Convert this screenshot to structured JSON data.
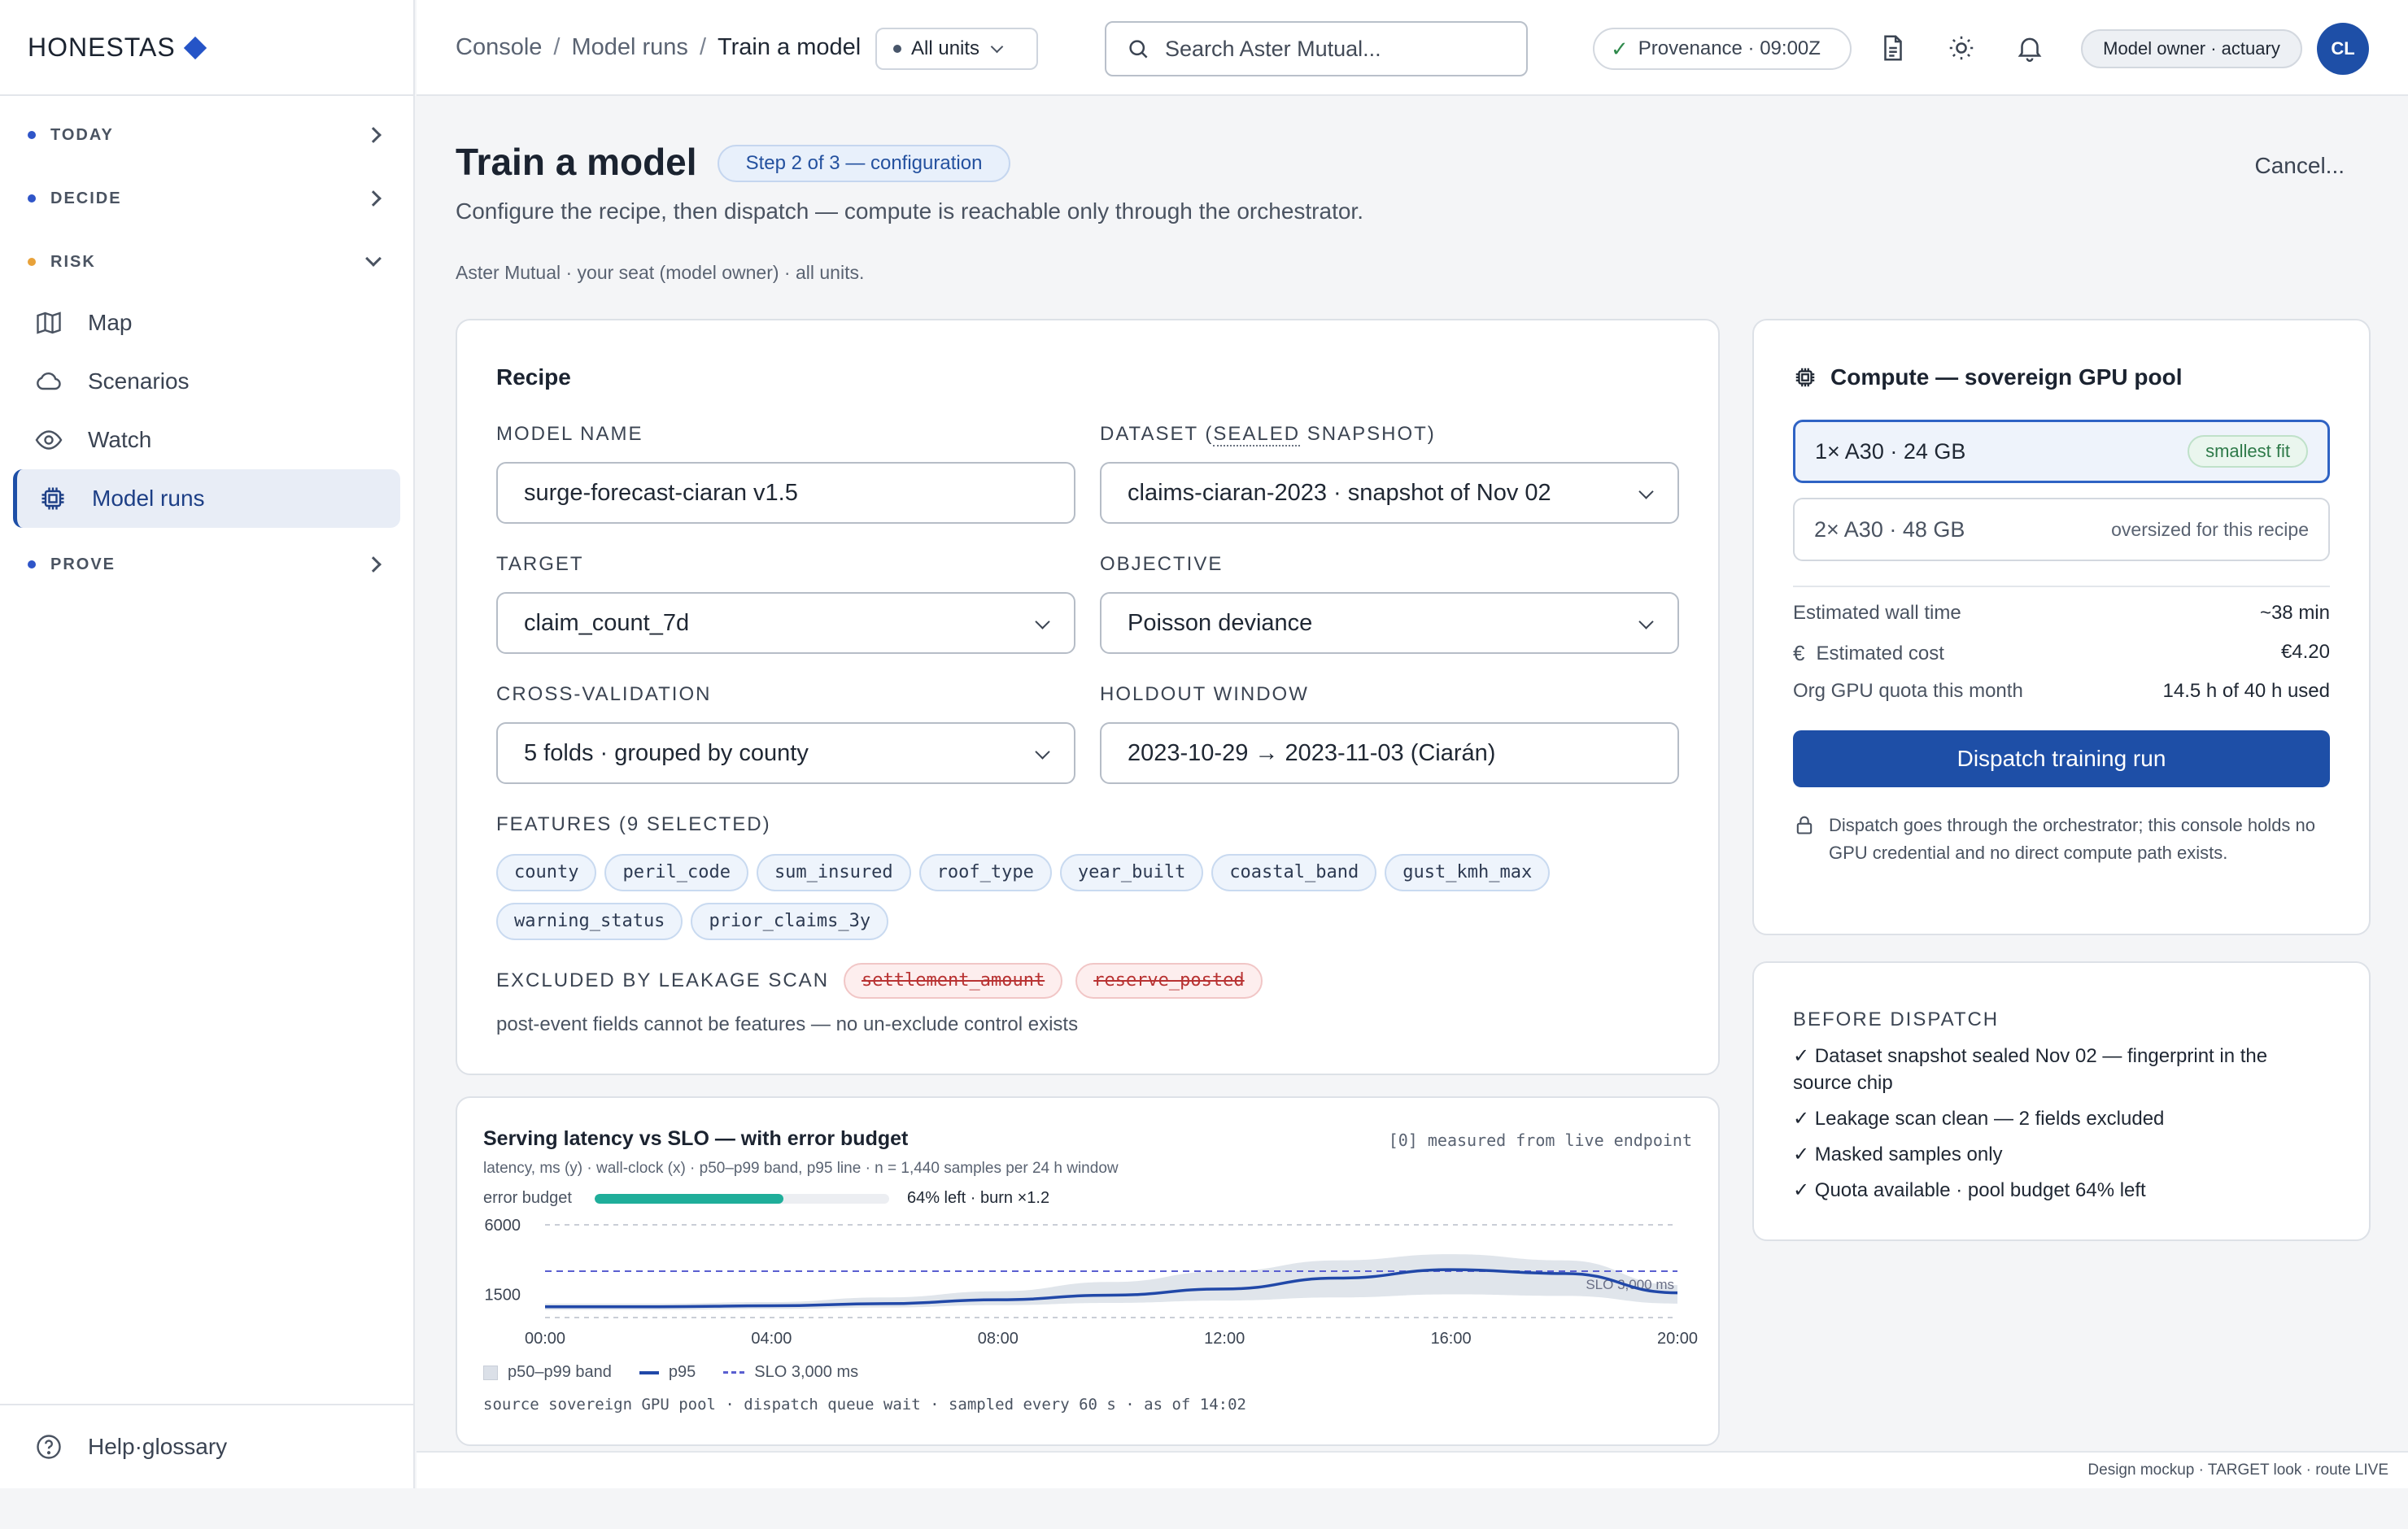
{
  "brand": {
    "name": "HONESTAS"
  },
  "sidebar": {
    "sections": [
      {
        "label": "TODAY"
      },
      {
        "label": "DECIDE"
      },
      {
        "label": "RISK"
      },
      {
        "label": "PROVE"
      }
    ],
    "items": [
      {
        "label": "Map",
        "icon": "map-icon"
      },
      {
        "label": "Scenarios",
        "icon": "cloud-icon"
      },
      {
        "label": "Watch",
        "icon": "eye-icon"
      },
      {
        "label": "Model runs",
        "icon": "chip-icon"
      }
    ],
    "help": "Help·glossary",
    "colors": {
      "accent": "#1e4fa7",
      "risk_dot": "#e8a23a"
    }
  },
  "topbar": {
    "breadcrumb": [
      "Console",
      "Model runs",
      "Train a model"
    ],
    "units": "All units",
    "search_placeholder": "Search Aster Mutual...",
    "provenance": "Provenance · 09:00Z",
    "role": "Model owner · actuary",
    "avatar": "CL"
  },
  "page": {
    "title": "Train a model",
    "step": "Step 2 of 3 — configuration",
    "cancel": "Cancel...",
    "subtitle": "Configure the recipe, then dispatch — compute is reachable only through the orchestrator.",
    "context": "Aster Mutual · your seat (model owner) · all units."
  },
  "recipe": {
    "heading": "Recipe",
    "model_name_label": "MODEL NAME",
    "model_name": "surge-forecast-ciaran v1.5",
    "dataset_label_pre": "DATASET (",
    "dataset_label_sealed": "SEALED",
    "dataset_label_post": " SNAPSHOT)",
    "dataset": "claims-ciaran-2023 · snapshot of Nov 02",
    "target_label": "TARGET",
    "target": "claim_count_7d",
    "objective_label": "OBJECTIVE",
    "objective": "Poisson deviance",
    "cv_label": "CROSS-VALIDATION",
    "cv": "5 folds · grouped by county",
    "holdout_label": "HOLDOUT WINDOW",
    "holdout": "2023-10-29 → 2023-11-03 (Ciarán)",
    "features_label": "FEATURES (9 SELECTED)",
    "features": [
      "county",
      "peril_code",
      "sum_insured",
      "roof_type",
      "year_built",
      "coastal_band",
      "gust_kmh_max",
      "warning_status",
      "prior_claims_3y"
    ],
    "excluded_label": "EXCLUDED BY LEAKAGE SCAN",
    "excluded": [
      "settlement_amount",
      "reserve_posted"
    ],
    "excluded_note": "post-event fields cannot be features — no un-exclude control exists"
  },
  "compute": {
    "heading": "Compute — sovereign GPU pool",
    "options": [
      {
        "label": "1× A30 · 24 GB",
        "tag": "smallest fit"
      },
      {
        "label": "2× A30 · 48 GB",
        "tag": "oversized for this recipe"
      }
    ],
    "wall_time_label": "Estimated wall time",
    "wall_time": "~38 min",
    "cost_label": "Estimated cost",
    "cost": "€4.20",
    "quota_label": "Org GPU quota this month",
    "quota": "14.5 h of 40 h used",
    "dispatch": "Dispatch training run",
    "note": "Dispatch goes through the orchestrator; this console holds no GPU credential and no direct compute path exists."
  },
  "before_dispatch": {
    "heading": "BEFORE DISPATCH",
    "items": [
      "✓ Dataset snapshot sealed Nov 02 — fingerprint in the source chip",
      "✓ Leakage scan clean — 2 fields excluded",
      "✓ Masked samples only",
      "✓ Quota available · pool budget 64% left"
    ]
  },
  "chart": {
    "title": "Serving latency vs SLO — with error budget",
    "meta": "[0] measured from live endpoint",
    "sub": "latency, ms (y) · wall-clock (x) · p50–p99 band, p95 line · n = 1,440 samples per 24 h window",
    "budget_label": "error budget",
    "budget_fraction": 0.64,
    "budget_text": "64% left · burn ×1.2",
    "slo_inline": "SLO 3,000 ms",
    "legend": {
      "band": "p50–p99 band",
      "line": "p95",
      "slo": "SLO 3,000 ms"
    },
    "source": "source sovereign GPU pool · dispatch queue wait · sampled every 60 s · as of 14:02"
  },
  "chart_data": {
    "type": "line",
    "x": [
      "00:00",
      "02:00",
      "04:00",
      "06:00",
      "08:00",
      "10:00",
      "12:00",
      "14:00",
      "16:00",
      "18:00",
      "20:00"
    ],
    "x_ticks": [
      "00:00",
      "04:00",
      "08:00",
      "12:00",
      "16:00",
      "20:00"
    ],
    "y_ticks": [
      "6000",
      "1500"
    ],
    "ylim": [
      0,
      6000
    ],
    "slo": 3000,
    "series": [
      {
        "name": "p95",
        "values": [
          700,
          700,
          760,
          900,
          1150,
          1450,
          1850,
          2550,
          3100,
          2850,
          1600
        ]
      },
      {
        "name": "p50–p99 band",
        "low": [
          500,
          500,
          550,
          650,
          800,
          950,
          1100,
          1300,
          1500,
          1400,
          900
        ],
        "high": [
          900,
          900,
          1000,
          1300,
          1700,
          2300,
          3000,
          3700,
          4100,
          3700,
          2100
        ]
      }
    ],
    "colors": {
      "line": "#2148a8",
      "band": "#dbe0e8",
      "slo": "#5a5fd0",
      "budget": "#1fae9a"
    }
  },
  "footer": "Design mockup · TARGET look · route LIVE"
}
